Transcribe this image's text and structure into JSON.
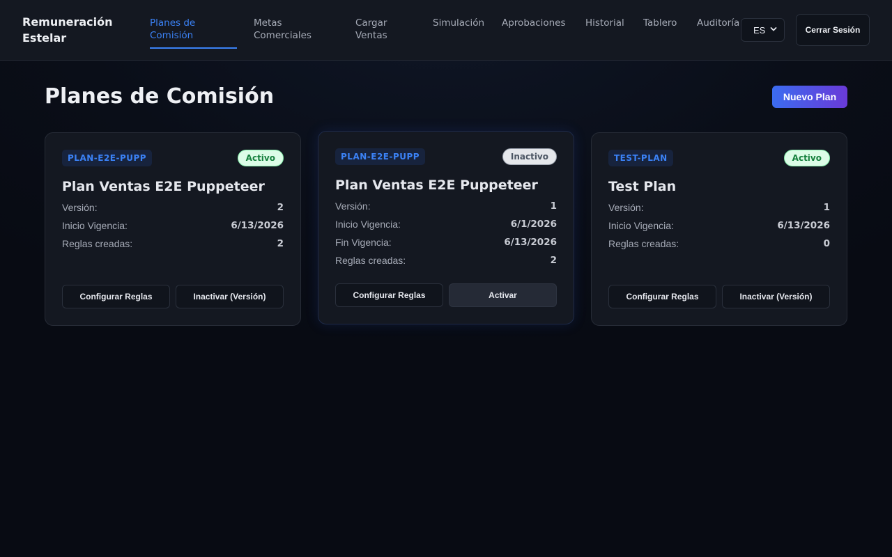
{
  "app": {
    "brand": "Remuneración Estelar"
  },
  "nav": {
    "items": [
      {
        "label": "Planes de Comisión",
        "active": true
      },
      {
        "label": "Metas Comerciales",
        "active": false
      },
      {
        "label": "Cargar Ventas",
        "active": false
      },
      {
        "label": "Simulación",
        "active": false
      },
      {
        "label": "Aprobaciones",
        "active": false
      },
      {
        "label": "Historial",
        "active": false
      },
      {
        "label": "Tablero",
        "active": false
      },
      {
        "label": "Auditoría",
        "active": false
      }
    ],
    "language": "ES",
    "logout_label": "Cerrar Sesión"
  },
  "page": {
    "title": "Planes de Comisión",
    "new_plan_label": "Nuevo Plan"
  },
  "colors": {
    "accent": "#3b82f6",
    "active_status": "#15803d",
    "inactive_status": "#4b5563",
    "button_gradient_start": "#3b6cf0",
    "button_gradient_end": "#6a3ad8"
  },
  "plans": [
    {
      "code": "PLAN-E2E-PUPP",
      "status": "Activo",
      "name": "Plan Ventas E2E Puppeteer",
      "fields": [
        {
          "label": "Versión:",
          "value": "2"
        },
        {
          "label": "Inicio Vigencia:",
          "value": "6/13/2026"
        },
        {
          "label": "Reglas creadas:",
          "value": "2"
        }
      ],
      "primary_action": "Configurar Reglas",
      "secondary_action": "Inactivar (Versión)"
    },
    {
      "code": "PLAN-E2E-PUPP",
      "status": "Inactivo",
      "name": "Plan Ventas E2E Puppeteer",
      "fields": [
        {
          "label": "Versión:",
          "value": "1"
        },
        {
          "label": "Inicio Vigencia:",
          "value": "6/1/2026"
        },
        {
          "label": "Fin Vigencia:",
          "value": "6/13/2026"
        },
        {
          "label": "Reglas creadas:",
          "value": "2"
        }
      ],
      "primary_action": "Configurar Reglas",
      "secondary_action": "Activar"
    },
    {
      "code": "TEST-PLAN",
      "status": "Activo",
      "name": "Test Plan",
      "fields": [
        {
          "label": "Versión:",
          "value": "1"
        },
        {
          "label": "Inicio Vigencia:",
          "value": "6/13/2026"
        },
        {
          "label": "Reglas creadas:",
          "value": "0"
        }
      ],
      "primary_action": "Configurar Reglas",
      "secondary_action": "Inactivar (Versión)"
    }
  ]
}
